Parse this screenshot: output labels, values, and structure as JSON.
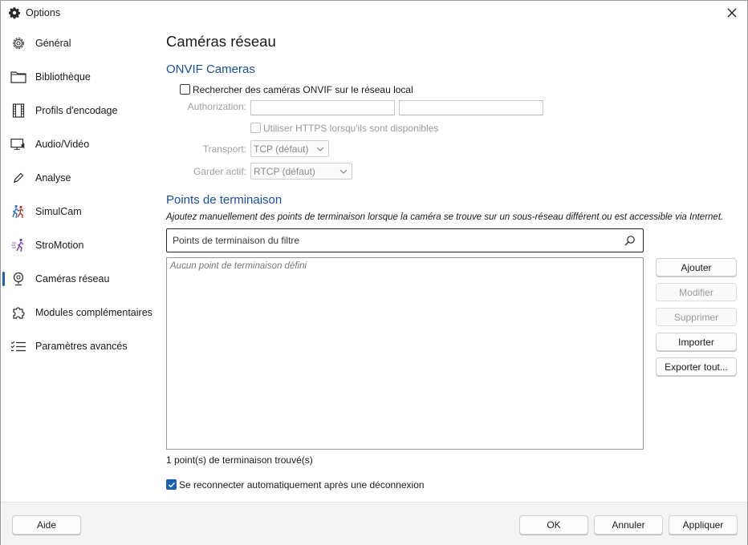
{
  "window": {
    "title": "Options",
    "icon": "gear-icon"
  },
  "sidebar": {
    "items": [
      {
        "label": "Général",
        "icon": "gear-icon"
      },
      {
        "label": "Bibliothèque",
        "icon": "folder-icon"
      },
      {
        "label": "Profils d'encodage",
        "icon": "film-icon"
      },
      {
        "label": "Audio/Vidéo",
        "icon": "monitor-audio-icon"
      },
      {
        "label": "Analyse",
        "icon": "pen-icon"
      },
      {
        "label": "SimulCam",
        "icon": "runners-icon"
      },
      {
        "label": "StroMotion",
        "icon": "motion-runner-icon"
      },
      {
        "label": "Caméras réseau",
        "icon": "webcam-icon",
        "active": true
      },
      {
        "label": "Modules complémentaires",
        "icon": "puzzle-icon"
      },
      {
        "label": "Paramètres avancés",
        "icon": "checklist-icon"
      }
    ]
  },
  "page": {
    "title": "Caméras réseau",
    "onvif": {
      "heading": "ONVIF Cameras",
      "search_local_label": "Rechercher des caméras ONVIF sur le réseau local",
      "search_local_checked": false,
      "authorization_label": "Authorization:",
      "auth_user_value": "",
      "auth_password_value": "",
      "https_label": "Utiliser HTTPS lorsqu'ils sont disponibles",
      "https_checked": false,
      "transport_label": "Transport:",
      "transport_value": "TCP (défaut)",
      "keepalive_label": "Garder actif:",
      "keepalive_value": "RTCP (défaut)"
    },
    "endpoints": {
      "heading": "Points de terminaison",
      "description": "Ajoutez manuellement des points de terminaison lorsque la caméra se trouve sur un sous-réseau différent ou est accessible via Internet.",
      "filter_placeholder": "Points de terminaison du filtre",
      "empty_text": "Aucun point de terminaison défini",
      "buttons": {
        "add": "Ajouter",
        "modify": "Modifier",
        "delete": "Supprimer",
        "import": "Importer",
        "export_all": "Exporter tout..."
      },
      "count_text": "1 point(s) de terminaison trouvé(s)",
      "auto_reconnect_label": "Se reconnecter automatiquement après une déconnexion",
      "auto_reconnect_checked": true
    }
  },
  "footer": {
    "help": "Aide",
    "ok": "OK",
    "cancel": "Annuler",
    "apply": "Appliquer"
  },
  "colors": {
    "accent": "#1a5fb4",
    "heading": "#1b4fa0"
  }
}
